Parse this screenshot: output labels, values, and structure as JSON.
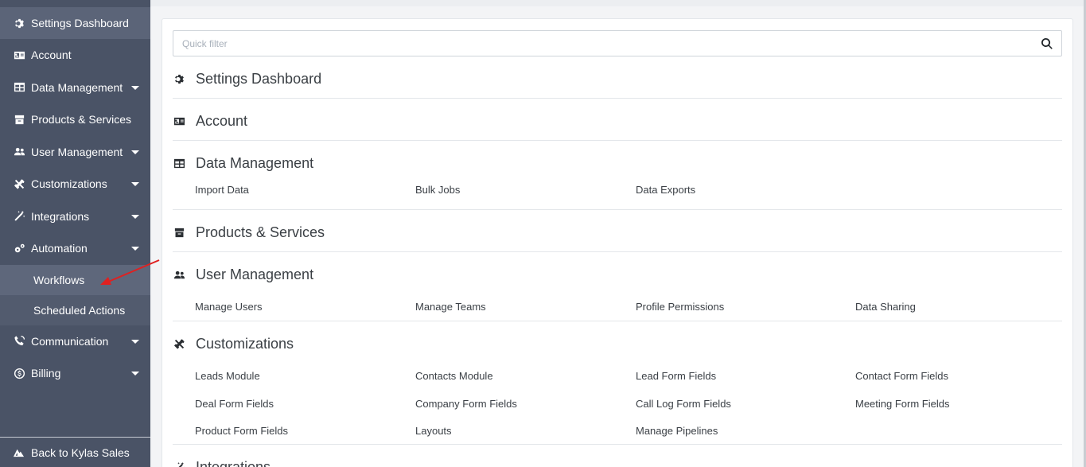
{
  "sidebar": {
    "items": [
      {
        "label": "Settings Dashboard",
        "icon": "gear-icon"
      },
      {
        "label": "Account",
        "icon": "id-card-icon"
      },
      {
        "label": "Data Management",
        "icon": "table-icon"
      },
      {
        "label": "Products & Services",
        "icon": "box-icon"
      },
      {
        "label": "User Management",
        "icon": "users-icon"
      },
      {
        "label": "Customizations",
        "icon": "tools-icon"
      },
      {
        "label": "Integrations",
        "icon": "magic-wand-icon"
      },
      {
        "label": "Automation",
        "icon": "cogs-icon"
      },
      {
        "label": "Communication",
        "icon": "phone-icon"
      },
      {
        "label": "Billing",
        "icon": "dollar-icon"
      }
    ],
    "automation_sub": [
      {
        "label": "Workflows"
      },
      {
        "label": "Scheduled Actions"
      }
    ],
    "back_label": "Back to Kylas Sales"
  },
  "search": {
    "placeholder": "Quick filter"
  },
  "sections": {
    "settings_dashboard": {
      "title": "Settings Dashboard"
    },
    "account": {
      "title": "Account"
    },
    "data_management": {
      "title": "Data Management",
      "links": [
        "Import Data",
        "Bulk Jobs",
        "Data Exports"
      ]
    },
    "products_services": {
      "title": "Products & Services"
    },
    "user_management": {
      "title": "User Management",
      "links": [
        "Manage Users",
        "Manage Teams",
        "Profile Permissions",
        "Data Sharing"
      ]
    },
    "customizations": {
      "title": "Customizations",
      "links": [
        "Leads Module",
        "Contacts Module",
        "Lead Form Fields",
        "Contact Form Fields",
        "Deal Form Fields",
        "Company Form Fields",
        "Call Log Form Fields",
        "Meeting Form Fields",
        "Product Form Fields",
        "Layouts",
        "Manage Pipelines"
      ]
    },
    "integrations": {
      "title": "Integrations"
    }
  },
  "colors": {
    "sidebar_bg": "#4a5366",
    "annotation_arrow": "#e02020"
  }
}
